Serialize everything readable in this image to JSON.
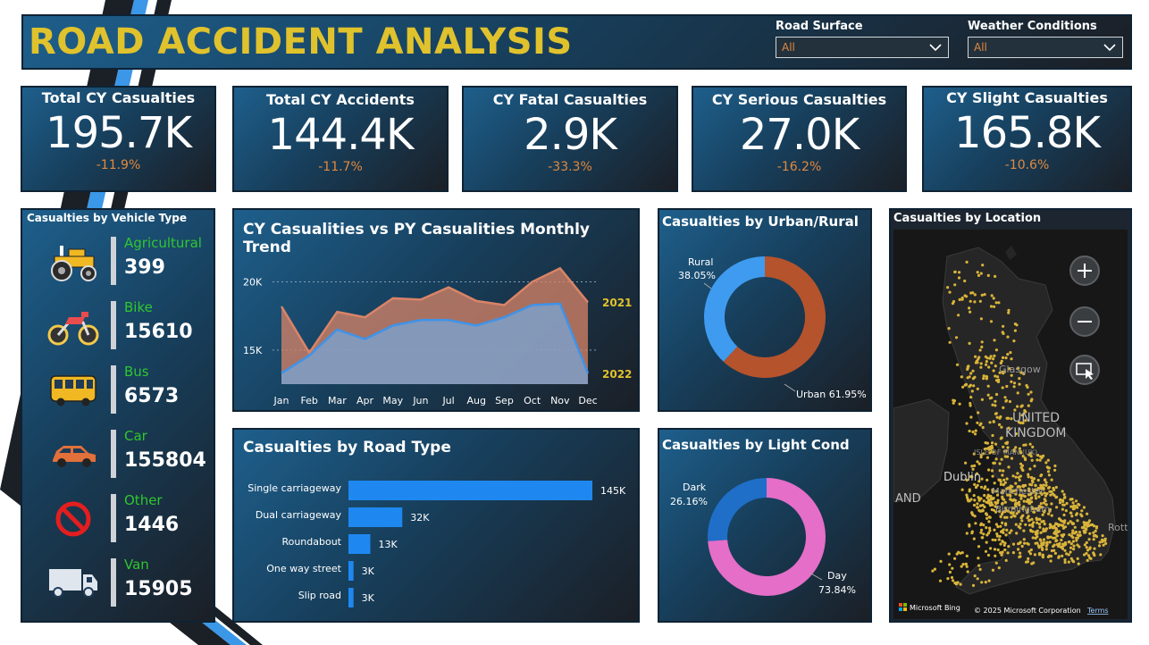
{
  "header": {
    "title": "ROAD ACCIDENT ANALYSIS",
    "slicers": [
      {
        "label": "Road Surface",
        "value": "All"
      },
      {
        "label": "Weather Conditions",
        "value": "All"
      }
    ]
  },
  "kpis": [
    {
      "title": "Total CY Casualties",
      "value": "195.7K",
      "delta": "-11.9%"
    },
    {
      "title": "Total CY Accidents",
      "value": "144.4K",
      "delta": "-11.7%"
    },
    {
      "title": "CY Fatal Casualties",
      "value": "2.9K",
      "delta": "-33.3%"
    },
    {
      "title": "CY Serious Casualties",
      "value": "27.0K",
      "delta": "-16.2%"
    },
    {
      "title": "CY Slight Casualties",
      "value": "165.8K",
      "delta": "-10.6%"
    }
  ],
  "vehicle_panel": {
    "title": "Casualties by Vehicle Type",
    "items": [
      {
        "name": "Agricultural",
        "value": "399",
        "icon": "tractor-icon"
      },
      {
        "name": "Bike",
        "value": "15610",
        "icon": "motorbike-icon"
      },
      {
        "name": "Bus",
        "value": "6573",
        "icon": "bus-icon"
      },
      {
        "name": "Car",
        "value": "155804",
        "icon": "car-icon"
      },
      {
        "name": "Other",
        "value": "1446",
        "icon": "prohibited-icon"
      },
      {
        "name": "Van",
        "value": "15905",
        "icon": "van-icon"
      }
    ]
  },
  "colors": {
    "accent_title": "#e0c22d",
    "delta": "#e0893f",
    "series_2021": "#d98467",
    "series_2022": "#3f93e8",
    "urban": "#b5532c",
    "rural": "#3f9bf0",
    "day": "#e46ec8",
    "dark": "#1f6fc8",
    "bar": "#1e88f0",
    "vehicle_name": "#2fc72f"
  },
  "chart_data": [
    {
      "type": "area",
      "title": "CY Casualities vs PY Casualities Monthly Trend",
      "categories": [
        "Jan",
        "Feb",
        "Mar",
        "Apr",
        "May",
        "Jun",
        "Jul",
        "Aug",
        "Sep",
        "Oct",
        "Nov",
        "Dec"
      ],
      "yticks": [
        "15K",
        "20K"
      ],
      "ylim": [
        12500,
        22000
      ],
      "series": [
        {
          "name": "2021",
          "values": [
            18200,
            14800,
            17800,
            17400,
            18800,
            18700,
            19600,
            18600,
            18300,
            20000,
            21000,
            18500
          ]
        },
        {
          "name": "2022",
          "values": [
            13300,
            14600,
            16500,
            15800,
            16800,
            17200,
            17200,
            16800,
            17400,
            18300,
            18400,
            13300
          ]
        }
      ],
      "grid": true
    },
    {
      "type": "bar",
      "title": "Casualties by Road Type",
      "categories": [
        "Single carriageway",
        "Dual carriageway",
        "Roundabout",
        "One way street",
        "Slip road"
      ],
      "values": [
        145,
        32,
        13,
        3,
        3
      ],
      "labels": [
        "145K",
        "32K",
        "13K",
        "3K",
        "3K"
      ],
      "orientation": "horizontal"
    },
    {
      "type": "pie",
      "title": "Casualties by Urban/Rural",
      "slices": [
        {
          "label": "Urban",
          "value": 61.95,
          "display": "Urban 61.95%"
        },
        {
          "label": "Rural",
          "value": 38.05,
          "display": "38.05%"
        }
      ],
      "donut": true
    },
    {
      "type": "pie",
      "title": "Casualties by Light Cond",
      "slices": [
        {
          "label": "Day",
          "value": 73.84,
          "display": "73.84%"
        },
        {
          "label": "Dark",
          "value": 26.16,
          "display": "26.16%"
        }
      ],
      "donut": true
    }
  ],
  "map": {
    "title": "Casualties by Location",
    "labels": [
      "Glasgow",
      "UNITED",
      "KINGDOM",
      "ISLE OF MAN (UK)",
      "Dublin",
      "Manchester",
      "Birmingham",
      "AND",
      "Rott"
    ],
    "attribution": "© 2025 Microsoft Corporation",
    "terms": "Terms",
    "bing": "Microsoft Bing",
    "controls": [
      "zoom-in-icon",
      "zoom-out-icon",
      "select-area-icon"
    ]
  }
}
